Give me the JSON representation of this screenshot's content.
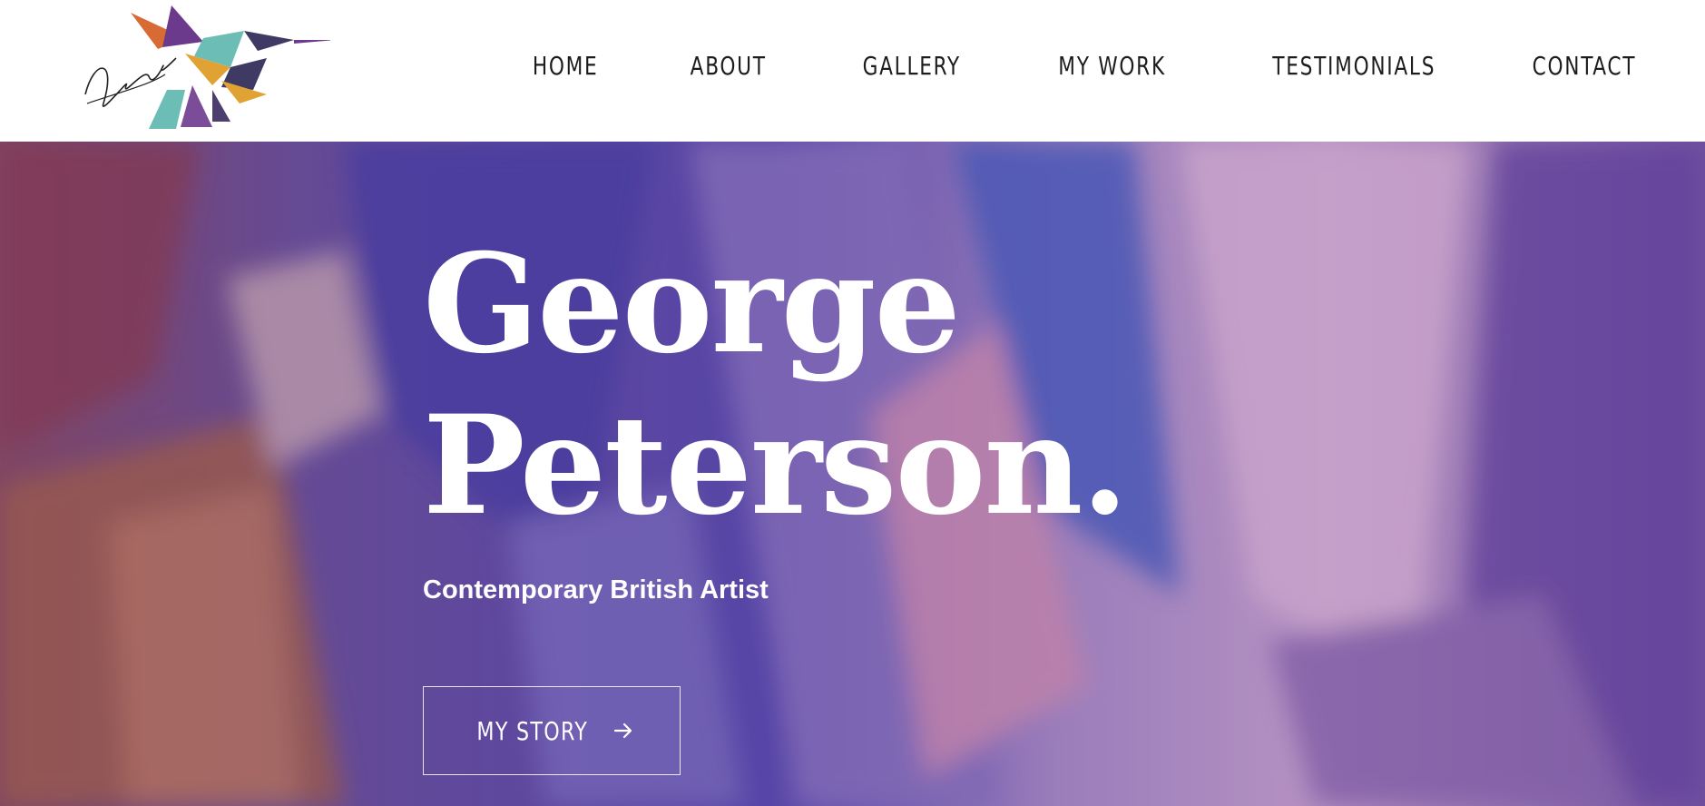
{
  "brand": {
    "logo_icon": "origami-hummingbird-icon",
    "colors": {
      "orange": "#d86b34",
      "purple": "#6b3a8c",
      "teal": "#6dbdb7",
      "gold": "#e0a233",
      "navy": "#3e3a63"
    }
  },
  "nav": {
    "items": [
      {
        "label": "HOME"
      },
      {
        "label": "ABOUT"
      },
      {
        "label": "GALLERY"
      },
      {
        "label": "MY WORK"
      },
      {
        "label": "TESTIMONIALS"
      },
      {
        "label": "CONTACT"
      }
    ]
  },
  "hero": {
    "title_line1": "George",
    "title_line2": "Peterson.",
    "subtitle": "Contemporary British Artist",
    "cta_label": "MY STORY",
    "cta_icon": "arrow-right-icon"
  }
}
